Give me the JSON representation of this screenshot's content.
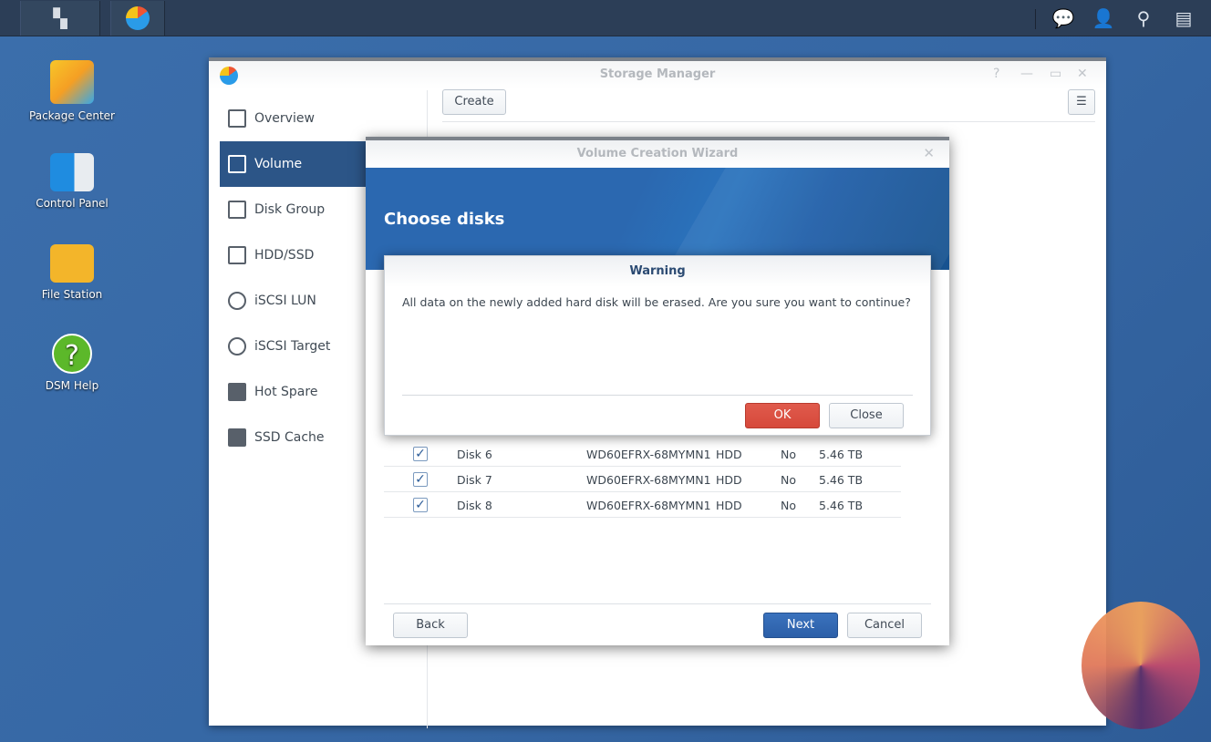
{
  "desktop": {
    "icons": [
      {
        "label": "Package Center"
      },
      {
        "label": "Control Panel"
      },
      {
        "label": "File Station"
      },
      {
        "label": "DSM Help"
      }
    ]
  },
  "window": {
    "title": "Storage Manager",
    "create_label": "Create",
    "sidebar": [
      {
        "label": "Overview"
      },
      {
        "label": "Volume"
      },
      {
        "label": "Disk Group"
      },
      {
        "label": "HDD/SSD"
      },
      {
        "label": "iSCSI LUN"
      },
      {
        "label": "iSCSI Target"
      },
      {
        "label": "Hot Spare"
      },
      {
        "label": "SSD Cache"
      }
    ]
  },
  "wizard": {
    "title": "Volume Creation Wizard",
    "heading": "Choose disks",
    "disks": [
      {
        "name": "Disk 6",
        "model": "WD60EFRX-68MYMN1",
        "type": "HDD",
        "flag": "No",
        "size": "5.46 TB",
        "checked": true
      },
      {
        "name": "Disk 7",
        "model": "WD60EFRX-68MYMN1",
        "type": "HDD",
        "flag": "No",
        "size": "5.46 TB",
        "checked": true
      },
      {
        "name": "Disk 8",
        "model": "WD60EFRX-68MYMN1",
        "type": "HDD",
        "flag": "No",
        "size": "5.46 TB",
        "checked": true
      }
    ],
    "back_label": "Back",
    "next_label": "Next",
    "cancel_label": "Cancel"
  },
  "warning": {
    "title": "Warning",
    "message": "All data on the newly added hard disk will be erased. Are you sure you want to continue?",
    "ok_label": "OK",
    "close_label": "Close"
  },
  "colors": {
    "primary": "#2c5fa8",
    "danger": "#d6493b",
    "sidebar_active": "#2c5587"
  }
}
